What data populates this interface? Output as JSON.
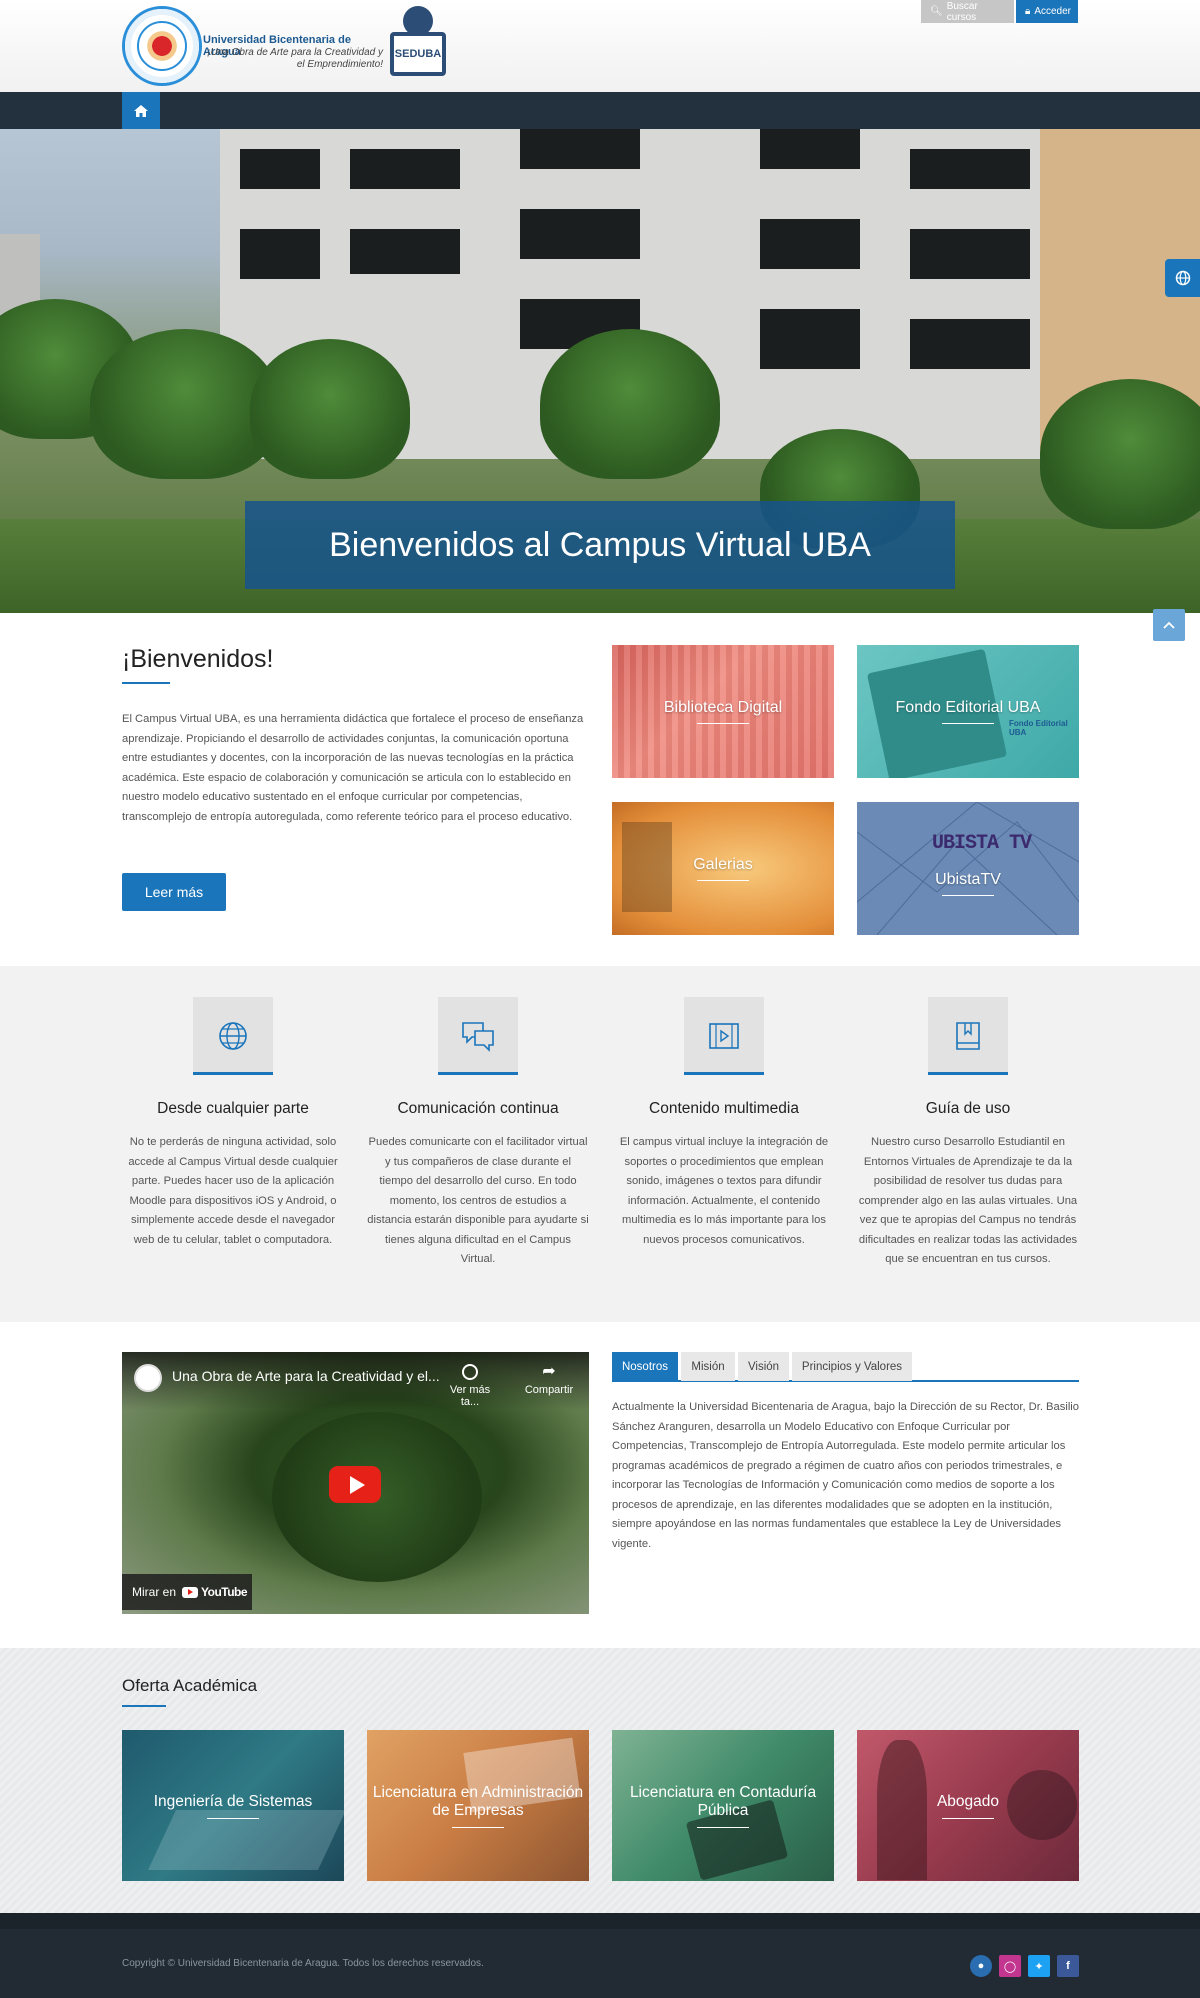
{
  "header": {
    "university_name": "Universidad Bicentenaria de Aragua",
    "tagline": "¡Una Obra de Arte para la Creatividad y el Emprendimiento!",
    "platform_logo_text": "SEDUBA",
    "search_button": "Buscar cursos",
    "login_button": "Acceder"
  },
  "nav": {
    "home_icon": "home-icon"
  },
  "hero": {
    "caption": "Bienvenidos al Campus Virtual UBA"
  },
  "welcome": {
    "title": "¡Bienvenidos!",
    "paragraph": "El Campus Virtual UBA, es una herramienta didáctica que fortalece el proceso de enseñanza aprendizaje. Propiciando el  desarrollo de actividades conjuntas,  la comunicación oportuna entre estudiantes y docentes, con la incorporación de las nuevas tecnologías en la práctica académica. Este espacio de colaboración y comunicación se articula con lo establecido en nuestro modelo educativo sustentado en el enfoque curricular por competencias, transcomplejo de entropía autoregulada, como referente teórico para el proceso educativo.",
    "read_more": "Leer más"
  },
  "tiles": [
    {
      "label": "Biblioteca Digital"
    },
    {
      "label": "Fondo Editorial UBA",
      "badge": "Fondo Editorial UBA"
    },
    {
      "label": "Galerias"
    },
    {
      "label": "UbistaTV",
      "badge": "UBISTA TV"
    }
  ],
  "features": [
    {
      "icon": "globe-icon",
      "title": "Desde cualquier parte",
      "text": "No te perderás de ninguna actividad, solo accede al Campus Virtual desde cualquier parte. Puedes hacer uso de la aplicación Moodle para dispositivos iOS y Android, o simplemente accede desde el navegador web de tu celular, tablet o computadora."
    },
    {
      "icon": "chat-icon",
      "title": "Comunicación continua",
      "text": "Puedes comunicarte con el facilitador virtual y tus compañeros de clase durante el tiempo del desarrollo del curso. En todo momento, los centros de estudios a distancia estarán disponible para ayudarte si tienes alguna dificultad en el Campus Virtual."
    },
    {
      "icon": "video-icon",
      "title": "Contenido multimedia",
      "text": "El campus virtual incluye la integración de soportes o procedimientos que emplean sonido, imágenes o textos para difundir información. Actualmente, el contenido multimedia es lo más importante para los nuevos procesos comunicativos."
    },
    {
      "icon": "book-icon",
      "title": "Guía de uso",
      "text": "Nuestro curso Desarrollo Estudiantil en Entornos Virtuales de Aprendizaje te da la posibilidad de resolver tus dudas para comprender algo en las aulas virtuales. Una vez que te apropias del Campus no tendrás dificultades en realizar todas las actividades que se encuentran en tus cursos."
    }
  ],
  "video": {
    "title": "Una Obra de Arte para la Creatividad y el...",
    "watch_later": "Ver más ta...",
    "share": "Compartir",
    "watch_on": "Mirar en",
    "youtube": "YouTube"
  },
  "tabs": {
    "items": [
      {
        "label": "Nosotros"
      },
      {
        "label": "Misión"
      },
      {
        "label": "Visión"
      },
      {
        "label": "Principios y Valores"
      }
    ],
    "active": "Nosotros",
    "content": "Actualmente la Universidad Bicentenaria de Aragua, bajo la Dirección de su Rector, Dr. Basilio Sánchez Aranguren, desarrolla un Modelo Educativo con Enfoque Curricular por Competencias, Transcomplejo de Entropía Autorregulada. Este modelo permite articular los programas académicos de pregrado a régimen de cuatro años con periodos trimestrales, e incorporar las Tecnologías de Información y Comunicación como medios de soporte a los procesos de aprendizaje, en las diferentes modalidades que se adopten en la institución, siempre apoyándose en las normas fundamentales que establece la Ley de Universidades vigente."
  },
  "oferta": {
    "title": "Oferta Académica",
    "cards": [
      {
        "label": "Ingeniería de Sistemas"
      },
      {
        "label": "Licenciatura en Administración de Empresas"
      },
      {
        "label": "Licenciatura en Contaduría Pública"
      },
      {
        "label": "Abogado"
      }
    ]
  },
  "footer": {
    "copyright": "Copyright © Universidad Bicentenaria de Aragua. Todos los derechos reservados.",
    "social": [
      {
        "icon": "web-icon",
        "color": "#2a6db0"
      },
      {
        "icon": "instagram-icon",
        "color": "#c2368f"
      },
      {
        "icon": "twitter-icon",
        "color": "#1da1f2"
      },
      {
        "icon": "facebook-icon",
        "color": "#3b5998"
      }
    ]
  },
  "colors": {
    "accent": "#1a75bb",
    "nav": "#22313d",
    "footer": "#222b33"
  }
}
